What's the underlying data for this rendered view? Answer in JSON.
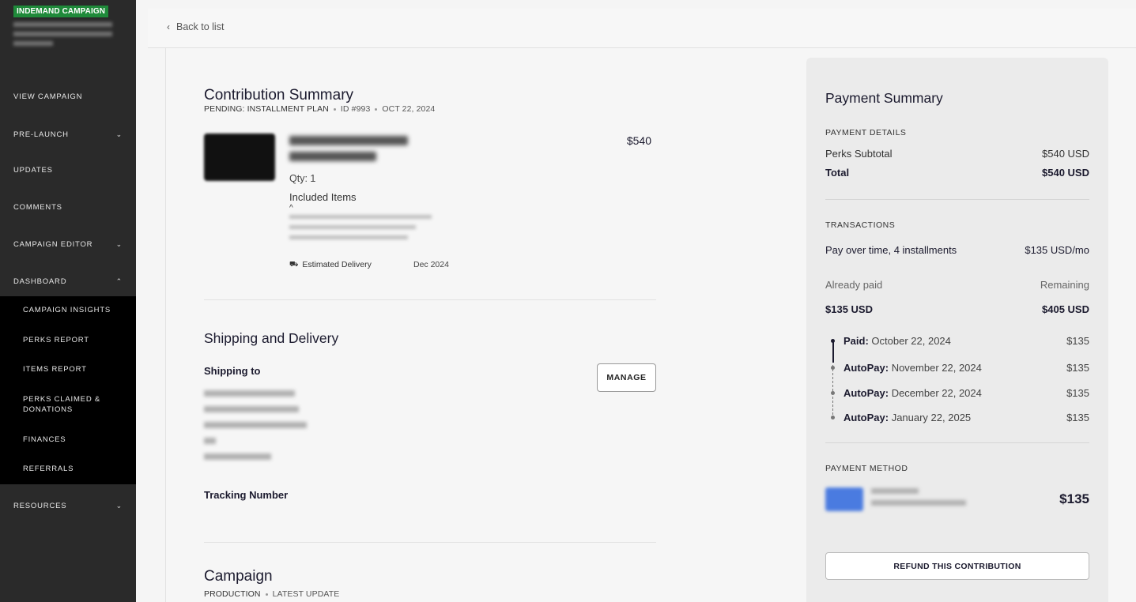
{
  "sidebar": {
    "badge": "INDEMAND CAMPAIGN",
    "nav": {
      "view_campaign": "VIEW CAMPAIGN",
      "pre_launch": "PRE-LAUNCH",
      "updates": "UPDATES",
      "comments": "COMMENTS",
      "campaign_editor": "CAMPAIGN EDITOR",
      "dashboard": "DASHBOARD",
      "resources": "RESOURCES"
    },
    "dashboard_items": [
      "CAMPAIGN INSIGHTS",
      "PERKS REPORT",
      "ITEMS REPORT",
      "PERKS CLAIMED & DONATIONS",
      "FINANCES",
      "REFERRALS"
    ],
    "chevron_down": "⌄",
    "chevron_up": "⌃"
  },
  "header": {
    "back_label": "Back to list"
  },
  "contribution": {
    "title": "Contribution Summary",
    "status": "PENDING: INSTALLMENT PLAN",
    "id": "ID #993",
    "date": "OCT 22, 2024",
    "price": "$540",
    "qty": "Qty: 1",
    "included_items": "Included Items",
    "estimated_delivery": "Estimated Delivery",
    "delivery_date": "Dec 2024"
  },
  "shipping": {
    "title": "Shipping and Delivery",
    "shipping_to": "Shipping to",
    "manage": "MANAGE",
    "tracking": "Tracking Number"
  },
  "campaign": {
    "title": "Campaign",
    "status": "PRODUCTION",
    "latest": "LATEST UPDATE"
  },
  "payment": {
    "title": "Payment Summary",
    "details_label": "PAYMENT DETAILS",
    "subtotal_label": "Perks Subtotal",
    "subtotal_value": "$540 USD",
    "total_label": "Total",
    "total_value": "$540 USD",
    "transactions_label": "TRANSACTIONS",
    "plan_label": "Pay over time, 4 installments",
    "plan_value": "$135 USD/mo",
    "paid_label": "Already paid",
    "remaining_label": "Remaining",
    "paid_value": "$135 USD",
    "remaining_value": "$405 USD",
    "installments": [
      {
        "type": "Paid:",
        "date": "October 22, 2024",
        "amount": "$135"
      },
      {
        "type": "AutoPay:",
        "date": "November 22, 2024",
        "amount": "$135"
      },
      {
        "type": "AutoPay:",
        "date": "December 22, 2024",
        "amount": "$135"
      },
      {
        "type": "AutoPay:",
        "date": "January 22, 2025",
        "amount": "$135"
      }
    ],
    "method_label": "PAYMENT METHOD",
    "method_amount": "$135",
    "refund": "REFUND THIS CONTRIBUTION"
  }
}
